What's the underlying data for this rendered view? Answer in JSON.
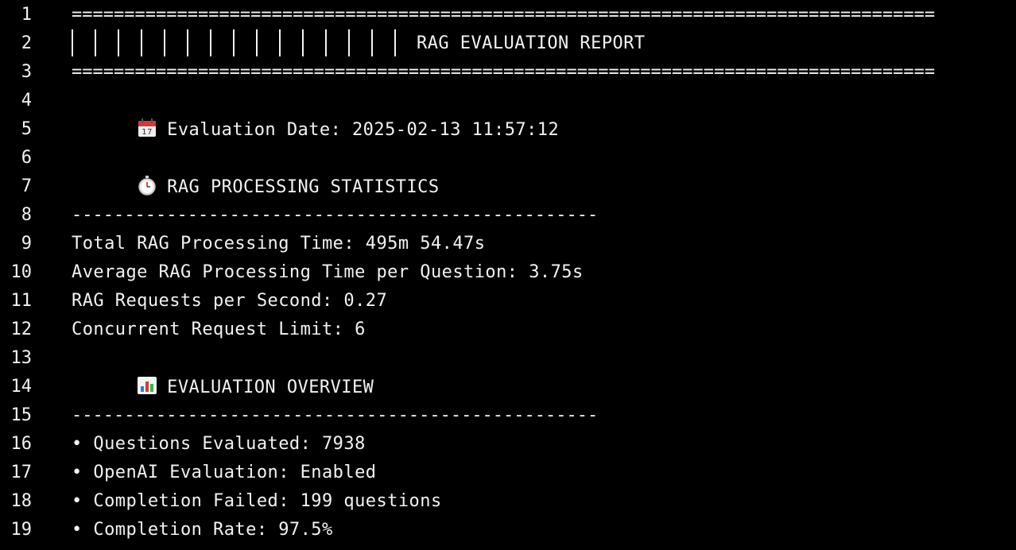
{
  "line_numbers": [
    "1",
    "2",
    "3",
    "4",
    "5",
    "6",
    "7",
    "8",
    "9",
    "10",
    "11",
    "12",
    "13",
    "14",
    "15",
    "16",
    "17",
    "18",
    "19"
  ],
  "rule_eq": "==================================================================================",
  "rule_dash": "--------------------------------------------------",
  "title": "RAG EVALUATION REPORT",
  "date_line": "Evaluation Date: 2025-02-13 11:57:12",
  "stats_heading": "RAG PROCESSING STATISTICS",
  "stats": [
    "Total RAG Processing Time: 495m 54.47s",
    "Average RAG Processing Time per Question: 3.75s",
    "RAG Requests per Second: 0.27",
    "Concurrent Request Limit: 6"
  ],
  "overview_heading": "EVALUATION OVERVIEW",
  "overview": [
    "• Questions Evaluated: 7938",
    "• OpenAI Evaluation: Enabled",
    "• Completion Failed: 199 questions",
    "• Completion Rate: 97.5%"
  ],
  "icons": {
    "date": "calendar-icon",
    "stats": "stopwatch-icon",
    "overview": "bar-chart-icon"
  },
  "colors": {
    "background": "#000000",
    "text": "#f2f2f2"
  }
}
